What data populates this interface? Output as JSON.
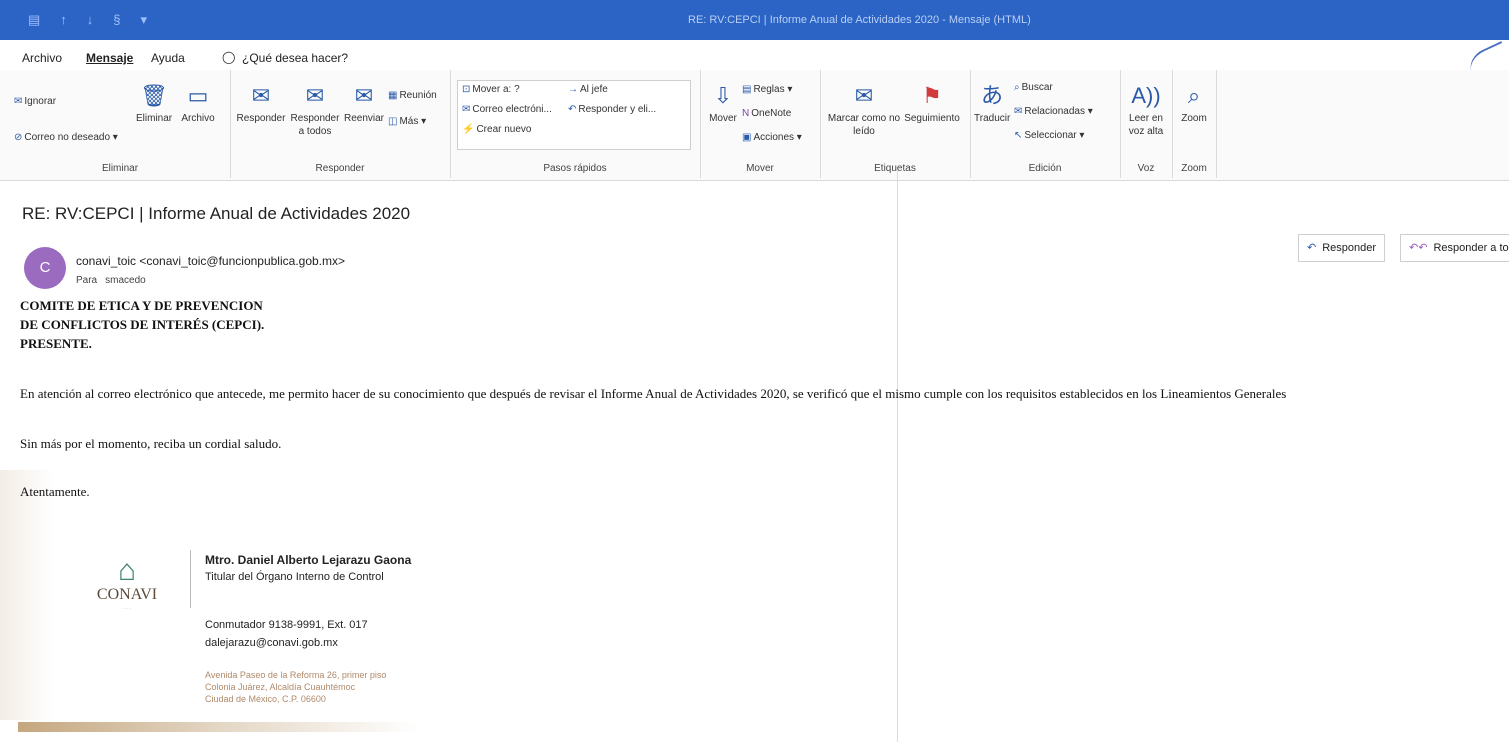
{
  "window": {
    "title": "RE: RV:CEPCI | Informe Anual de Actividades 2020  -  Mensaje (HTML)",
    "qat": [
      "▤",
      "↑",
      "↓",
      "§",
      "▾"
    ]
  },
  "menu": {
    "tabs": [
      "Archivo",
      "Mensaje",
      "Ayuda"
    ],
    "search_placeholder": "¿Qué desea hacer?"
  },
  "ribbon": {
    "eliminar": {
      "ignorar": "Ignorar",
      "no_deseado": "Correo no deseado ▾",
      "eliminar": "Eliminar",
      "archivo": "Archivo",
      "group": "Eliminar"
    },
    "responder": {
      "responder": "Responder",
      "responder_todos": "Responder a todos",
      "reenviar": "Reenviar",
      "reunion": "Reunión",
      "mas": "Más ▾",
      "group": "Responder"
    },
    "pasos": {
      "mover_a": "Mover a: ?",
      "al_jefe": "Al jefe",
      "correo": "Correo electróni...",
      "responder_eli": "Responder y eli...",
      "crear_nuevo": "Crear nuevo",
      "group": "Pasos rápidos"
    },
    "mover": {
      "mover": "Mover",
      "reglas": "Reglas ▾",
      "onenote": "OneNote",
      "acciones": "Acciones ▾",
      "group": "Mover"
    },
    "etiquetas": {
      "marcar": "Marcar como no leído",
      "seguimiento": "Seguimiento",
      "group": "Etiquetas"
    },
    "edicion": {
      "traducir": "Traducir",
      "buscar": "Buscar",
      "relacionadas": "Relacionadas ▾",
      "seleccionar": "Seleccionar ▾",
      "group": "Edición"
    },
    "voz": {
      "leer": "Leer en voz alta",
      "group": "Voz"
    },
    "zoom": {
      "zoom": "Zoom",
      "group": "Zoom"
    }
  },
  "email": {
    "subject": "RE: RV:CEPCI | Informe Anual de Actividades 2020",
    "avatar_initial": "C",
    "sender": "conavi_toic <conavi_toic@funcionpublica.gob.mx>",
    "to_label": "Para",
    "to": "smacedo",
    "reply_label": "Responder",
    "reply_all_label": "Responder a todos",
    "body_heading": [
      "COMITE DE ETICA Y DE PREVENCION",
      "DE CONFLICTOS DE INTERÉS (CEPCI).",
      "PRESENTE."
    ],
    "body_paragraph": "En atención al correo electrónico que antecede, me permito hacer de su conocimiento que después de revisar el Informe Anual de Actividades 2020, se verificó que el mismo cumple con los requisitos establecidos en los Lineamientos Generales",
    "closing1": "Sin más por el momento, reciba un cordial saludo.",
    "closing2": "Atentamente."
  },
  "signature": {
    "logo_text": "CONAVI",
    "name": "Mtro. Daniel Alberto Lejarazu Gaona",
    "title": "Titular del Órgano Interno de Control",
    "phone": "Conmutador 9138-9991, Ext. 017",
    "email": "dalejarazu@conavi.gob.mx",
    "address1": "Avenida Paseo de la Reforma 26, primer piso",
    "address2": "Colonia Juárez, Alcaldía Cuauhtémoc",
    "address3": "Ciudad de México, C.P. 06600"
  },
  "colors": {
    "titlebar": "#2b64c4",
    "accent": "#2a5aa8",
    "avatar": "#9b6bbf"
  }
}
